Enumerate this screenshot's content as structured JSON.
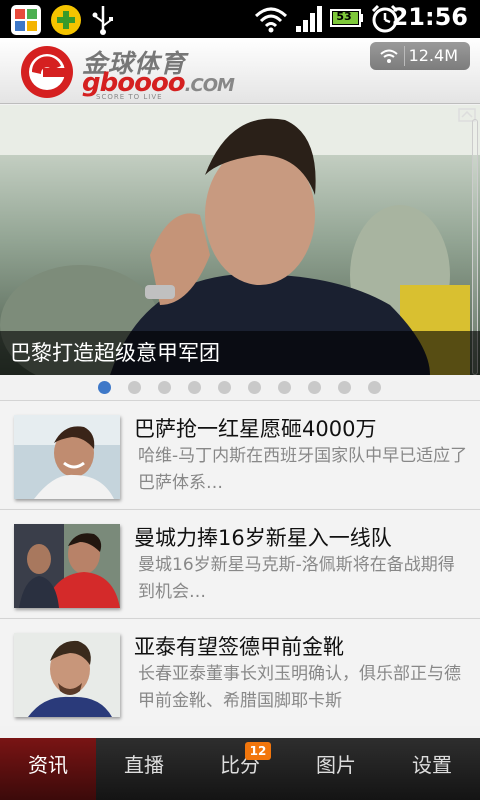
{
  "status_bar": {
    "time": "21:56",
    "battery_level": "53",
    "icons": [
      "app-icon",
      "plus-icon",
      "usb-icon",
      "wifi-icon",
      "signal-icon",
      "battery-icon",
      "alarm-icon"
    ]
  },
  "header": {
    "logo_cn": "金球体育",
    "logo_en": "gboooo",
    "logo_com": ".COM",
    "logo_tagline": "SCORE TO LIVE",
    "data_usage": "12.4M"
  },
  "hero": {
    "caption": "巴黎打造超级意甲军团",
    "page_count": 10,
    "active_page": 0
  },
  "news": [
    {
      "title": "巴萨抢一红星愿砸4000万",
      "summary": "哈维-马丁内斯在西班牙国家队中早已适应了巴萨体系…"
    },
    {
      "title": "曼城力捧16岁新星入一线队",
      "summary": "曼城16岁新星马克斯-洛佩斯将在备战期得到机会…"
    },
    {
      "title": "亚泰有望签德甲前金靴",
      "summary": "长春亚泰董事长刘玉明确认，俱乐部正与德甲前金靴、希腊国脚耶卡斯"
    }
  ],
  "tabs": [
    {
      "label": "资讯",
      "active": true
    },
    {
      "label": "直播",
      "active": false
    },
    {
      "label": "比分",
      "active": false
    },
    {
      "label": "图片",
      "active": false
    },
    {
      "label": "设置",
      "active": false
    }
  ],
  "tab_badge": "12",
  "colors": {
    "accent_red": "#d52020",
    "dot_active": "#3e78c8",
    "badge_orange": "#f2760c"
  }
}
